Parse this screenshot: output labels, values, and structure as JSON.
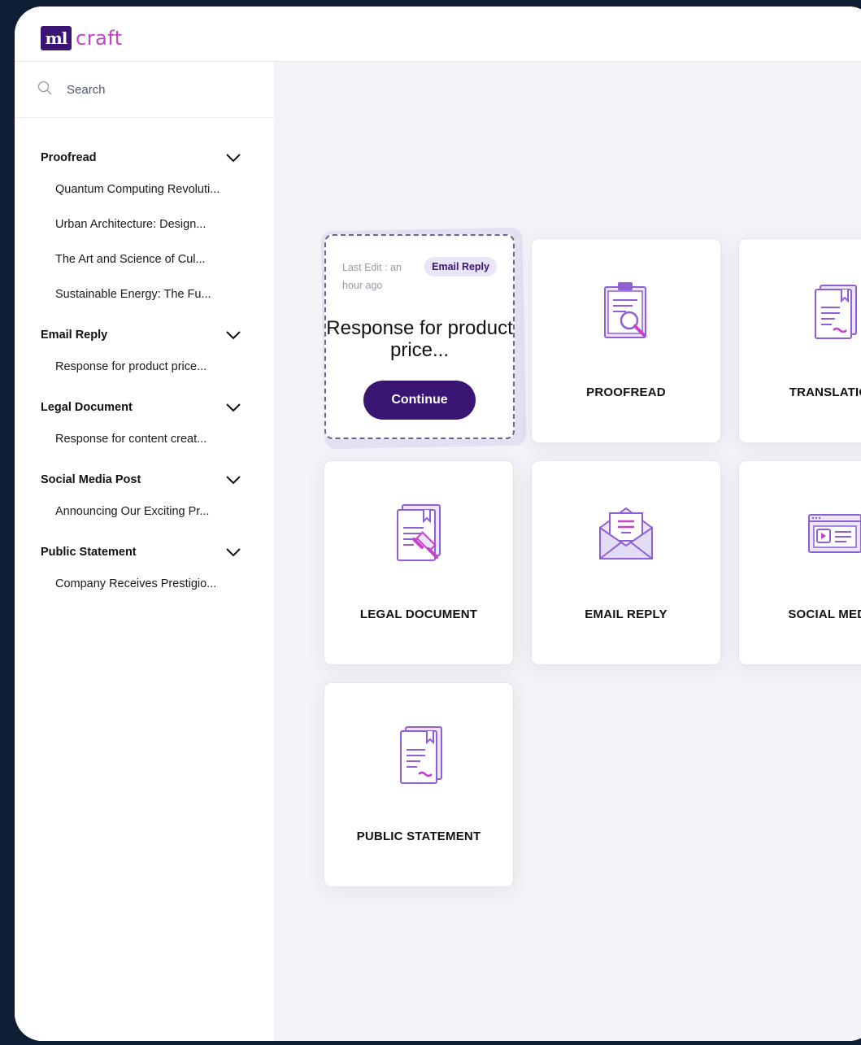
{
  "brand": {
    "logo_mark": "ml",
    "logo_text": "craft"
  },
  "search": {
    "placeholder": "Search"
  },
  "sidebar": {
    "sections": [
      {
        "title": "Proofread",
        "items": [
          "Quantum Computing Revoluti...",
          "Urban Architecture: Design...",
          "The Art and Science of Cul...",
          "Sustainable Energy: The Fu..."
        ]
      },
      {
        "title": "Email Reply",
        "items": [
          "Response for product price..."
        ]
      },
      {
        "title": "Legal Document",
        "items": [
          "Response for content creat..."
        ]
      },
      {
        "title": "Social Media Post",
        "items": [
          "Announcing Our Exciting Pr..."
        ]
      },
      {
        "title": "Public Statement",
        "items": [
          "Company Receives Prestigio..."
        ]
      }
    ]
  },
  "recent": {
    "time": "Last Edit : an hour ago",
    "badge": "Email Reply",
    "title": "Response for product price...",
    "button": "Continue"
  },
  "cards": {
    "proofread": "PROOFREAD",
    "translation": "TRANSLATION",
    "legal": "LEGAL DOCUMENT",
    "email": "EMAIL REPLY",
    "social": "SOCIAL MEDIA",
    "public": "PUBLIC STATEMENT"
  },
  "colors": {
    "primary": "#3b1573",
    "accent": "#c243c7",
    "icon_stroke": "#8e5fd6",
    "frame": "#0f1e33"
  }
}
